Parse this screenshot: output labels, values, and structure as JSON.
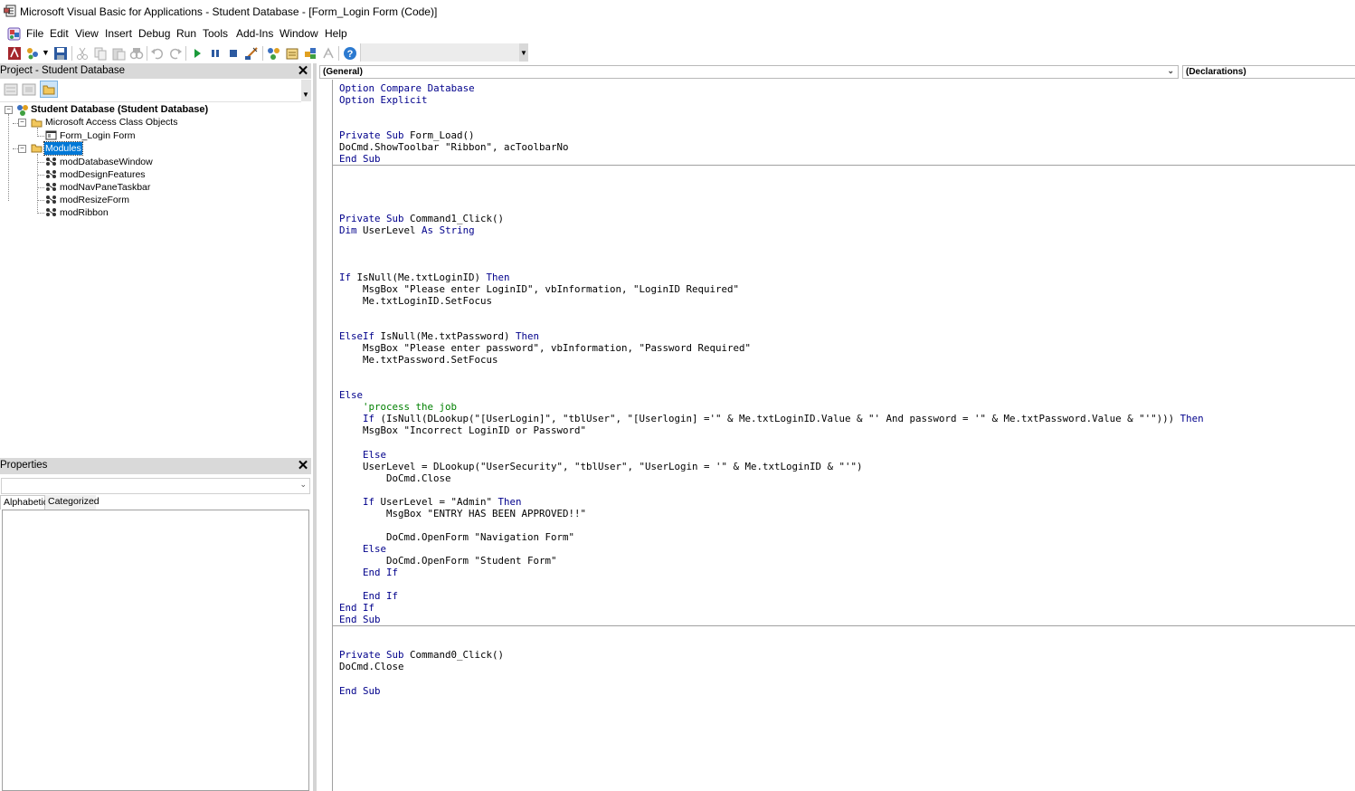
{
  "window": {
    "title": "Microsoft Visual Basic for Applications - Student Database - [Form_Login Form (Code)]"
  },
  "menu": [
    "File",
    "Edit",
    "View",
    "Insert",
    "Debug",
    "Run",
    "Tools",
    "Add-Ins",
    "Window",
    "Help"
  ],
  "toolbar": {
    "icons": [
      "view-access-icon",
      "insert-module-icon",
      "save-icon",
      "cut-icon",
      "copy-icon",
      "paste-icon",
      "find-icon",
      "undo-icon",
      "redo-icon",
      "run-icon",
      "break-icon",
      "reset-icon",
      "design-mode-icon",
      "project-explorer-icon",
      "properties-window-icon",
      "object-browser-icon",
      "toolbox-icon",
      "help-icon"
    ]
  },
  "project": {
    "title": "Project - Student Database",
    "tree": {
      "root": "Student Database (Student Database)",
      "folder1": "Microsoft Access Class Objects",
      "form_item": "Form_Login Form",
      "folder2": "Modules",
      "modules": [
        "modDatabaseWindow",
        "modDesignFeatures",
        "modNavPaneTaskbar",
        "modResizeForm",
        "modRibbon"
      ]
    }
  },
  "properties": {
    "title": "Properties",
    "tabs": [
      "Alphabetic",
      "Categorized"
    ]
  },
  "code": {
    "object_combo": "(General)",
    "procedure_combo": "(Declarations)",
    "lines": [
      {
        "t": "Option Compare Database",
        "k": [
          "Option Compare Database"
        ]
      },
      {
        "t": "Option Explicit"
      },
      {
        "t": ""
      },
      {
        "t": ""
      },
      {
        "t": "Private Sub Form_Load()"
      },
      {
        "t": "DoCmd.ShowToolbar \"Ribbon\", acToolbarNo"
      },
      {
        "t": "End Sub"
      },
      {
        "t": ""
      },
      {
        "t": ""
      },
      {
        "t": ""
      },
      {
        "t": ""
      },
      {
        "t": "Private Sub Command1_Click()"
      },
      {
        "t": "Dim UserLevel As String"
      },
      {
        "t": ""
      },
      {
        "t": ""
      },
      {
        "t": ""
      },
      {
        "t": "If IsNull(Me.txtLoginID) Then"
      },
      {
        "t": "    MsgBox \"Please enter LoginID\", vbInformation, \"LoginID Required\""
      },
      {
        "t": "    Me.txtLoginID.SetFocus"
      },
      {
        "t": ""
      },
      {
        "t": ""
      },
      {
        "t": "ElseIf IsNull(Me.txtPassword) Then"
      },
      {
        "t": "    MsgBox \"Please enter password\", vbInformation, \"Password Required\""
      },
      {
        "t": "    Me.txtPassword.SetFocus"
      },
      {
        "t": ""
      },
      {
        "t": ""
      },
      {
        "t": "Else"
      },
      {
        "t": "    'process the job"
      },
      {
        "t": "    If (IsNull(DLookup(\"[UserLogin]\", \"tblUser\", \"[Userlogin] ='\" & Me.txtLoginID.Value & \"' And password = '\" & Me.txtPassword.Value & \"'\"))) Then"
      },
      {
        "t": "    MsgBox \"Incorrect LoginID or Password\""
      },
      {
        "t": ""
      },
      {
        "t": "    Else"
      },
      {
        "t": "    UserLevel = DLookup(\"UserSecurity\", \"tblUser\", \"UserLogin = '\" & Me.txtLoginID & \"'\")"
      },
      {
        "t": "        DoCmd.Close"
      },
      {
        "t": ""
      },
      {
        "t": "    If UserLevel = \"Admin\" Then"
      },
      {
        "t": "        MsgBox \"ENTRY HAS BEEN APPROVED!!\""
      },
      {
        "t": ""
      },
      {
        "t": "        DoCmd.OpenForm \"Navigation Form\""
      },
      {
        "t": "    Else"
      },
      {
        "t": "        DoCmd.OpenForm \"Student Form\""
      },
      {
        "t": "    End If"
      },
      {
        "t": ""
      },
      {
        "t": "    End If"
      },
      {
        "t": "End If"
      },
      {
        "t": "End Sub"
      },
      {
        "t": ""
      },
      {
        "t": ""
      },
      {
        "t": "Private Sub Command0_Click()"
      },
      {
        "t": "DoCmd.Close"
      },
      {
        "t": ""
      },
      {
        "t": "End Sub"
      }
    ]
  }
}
